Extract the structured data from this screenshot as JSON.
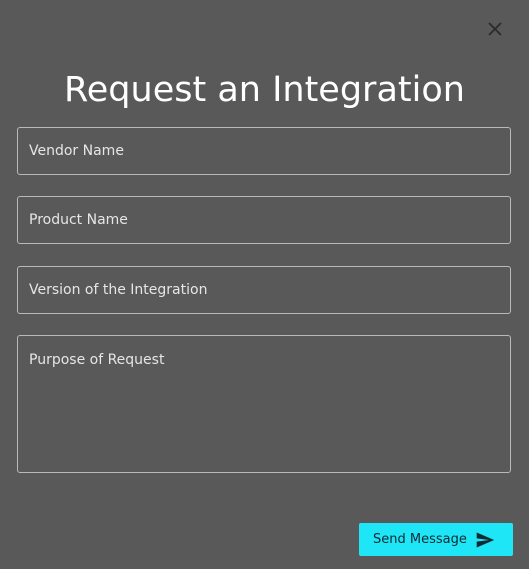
{
  "modal": {
    "title": "Request an Integration",
    "close_icon": "close-icon"
  },
  "form": {
    "vendor_name": {
      "value": "",
      "placeholder": "Vendor Name"
    },
    "product_name": {
      "value": "",
      "placeholder": "Product Name"
    },
    "integration_version": {
      "value": "",
      "placeholder": "Version of the Integration"
    },
    "purpose": {
      "value": "",
      "placeholder": "Purpose of Request"
    },
    "submit": {
      "label": "Send Message",
      "icon": "send-icon"
    }
  },
  "colors": {
    "background": "#595959",
    "border": "#b9b9b9",
    "accent": "#1ee6f7",
    "title_text": "#ffffff"
  }
}
